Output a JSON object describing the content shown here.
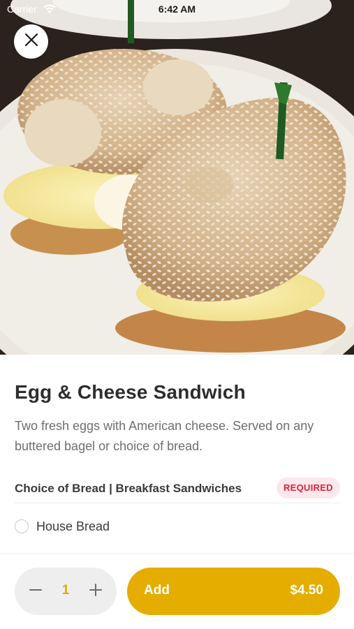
{
  "status_bar": {
    "carrier": "Carrier",
    "time": "6:42 AM"
  },
  "hero": {
    "image": "sesame-bagel-egg-cheese-sandwich-photo"
  },
  "item": {
    "title": "Egg & Cheese Sandwich",
    "description": "Two fresh eggs with American cheese. Served on any buttered bagel or choice of bread."
  },
  "options_group": {
    "title": "Choice of Bread | Breakfast Sandwiches",
    "badge": "REQUIRED",
    "options": [
      {
        "label": "House Bread",
        "selected": false
      }
    ]
  },
  "cart": {
    "quantity": "1",
    "add_label": "Add",
    "price": "$4.50"
  },
  "colors": {
    "accent": "#e5ad00",
    "quantity_text": "#e2a800",
    "required_text": "#e0203c",
    "required_bg": "#fde8ec"
  }
}
